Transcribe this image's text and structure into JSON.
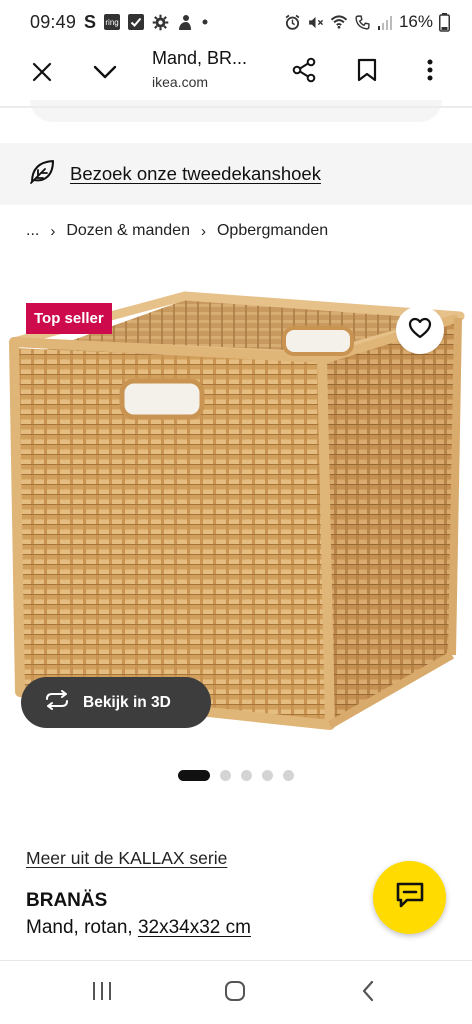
{
  "status_bar": {
    "time": "09:49",
    "s_label": "S",
    "ring_label": "ring",
    "battery": "16%"
  },
  "browser": {
    "page_title": "Mand, BR...",
    "url": "ikea.com"
  },
  "banner": {
    "link_text": "Bezoek onze tweedekanshoek"
  },
  "breadcrumb": {
    "ellipsis": "...",
    "separator": "›",
    "items": [
      "Dozen & manden",
      "Opbergmanden"
    ]
  },
  "product": {
    "badge": "Top seller",
    "view_3d_label": "Bekijk in 3D",
    "carousel_total": 5,
    "carousel_active": 1,
    "series_link": "Meer uit de KALLAX serie",
    "name": "BRANÄS",
    "description": "Mand, rotan, ",
    "dimensions": "32x34x32 cm"
  },
  "colors": {
    "badge": "#cc0a4c",
    "chat_fab": "#ffdb00",
    "banner_bg": "#f5f5f5",
    "view3d_bg": "#3d3d3d",
    "basket": "#d9a866"
  },
  "icons": [
    "close-icon",
    "chevron-down-icon",
    "share-icon",
    "bookmark-icon",
    "more-vert-icon",
    "leaf-icon",
    "heart-icon",
    "rotate-3d-icon",
    "chat-icon"
  ]
}
